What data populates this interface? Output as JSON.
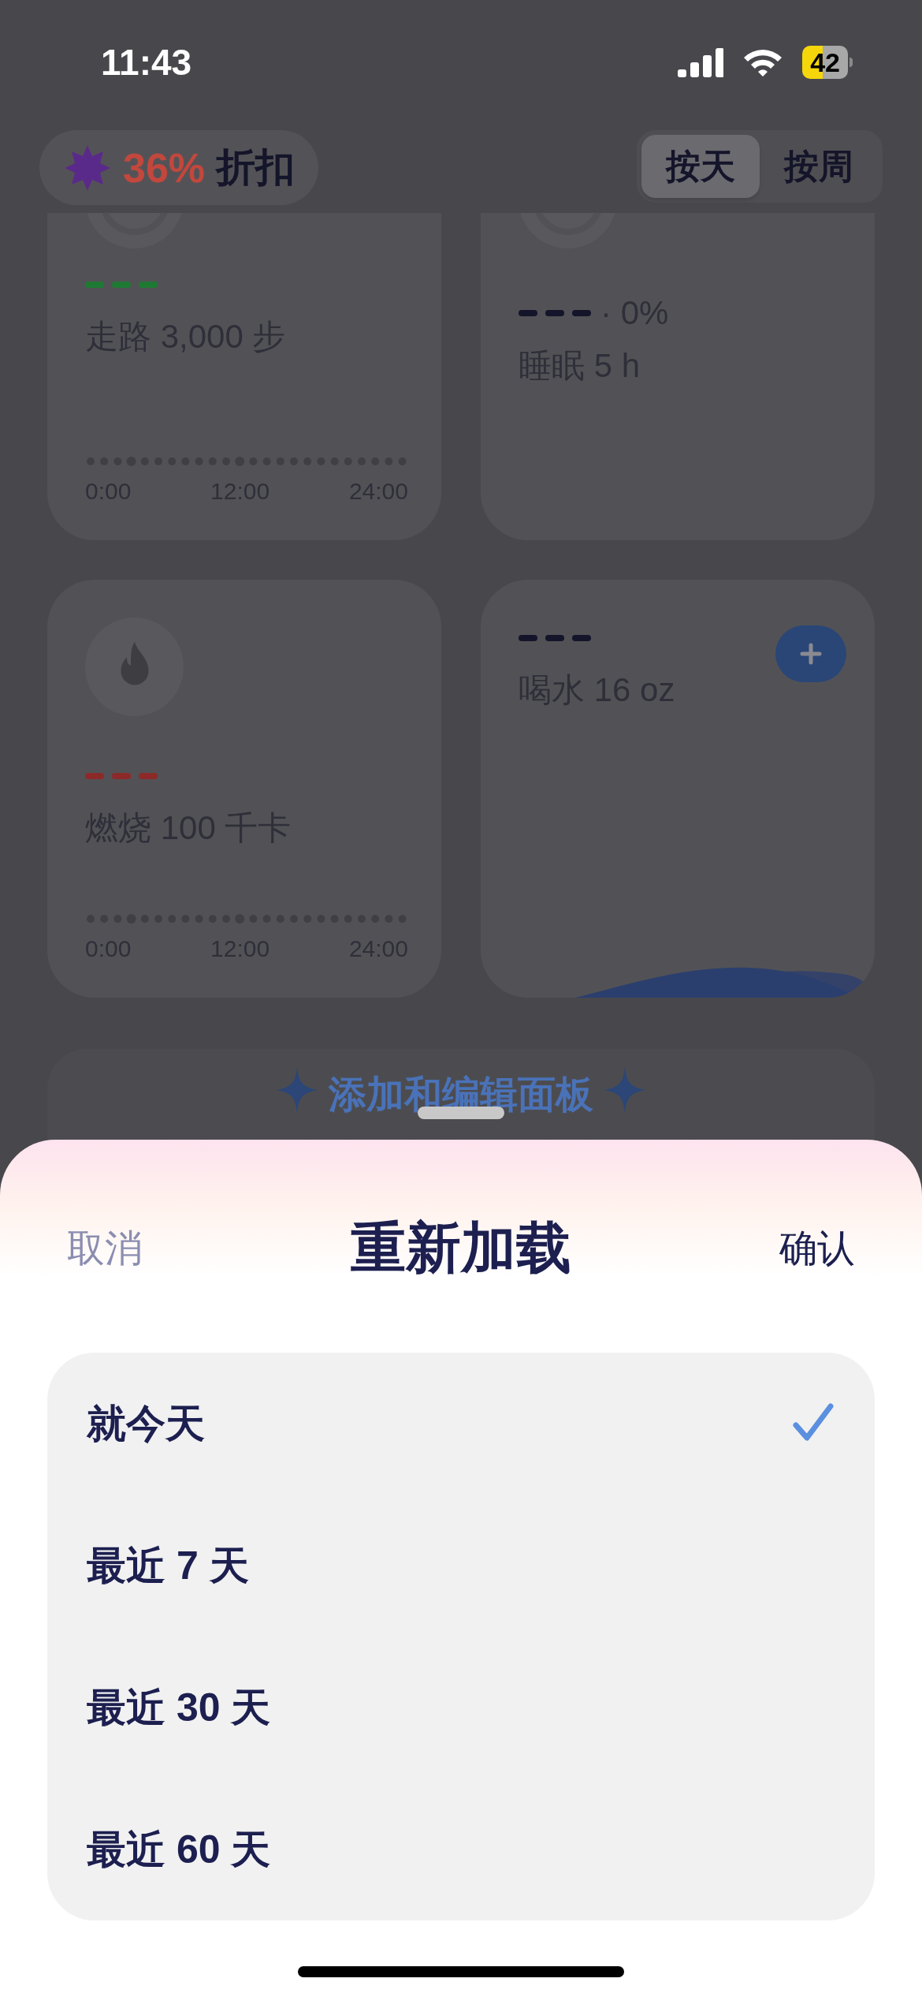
{
  "status_bar": {
    "time": "11:43",
    "battery": "42"
  },
  "discount": {
    "percent": "36%",
    "label": "折扣"
  },
  "segments": [
    {
      "label": "按天",
      "selected": true
    },
    {
      "label": "按周",
      "selected": false
    }
  ],
  "cards": [
    {
      "kind": "timeline",
      "color": "#1e7a33",
      "label": "走路 3,000 步",
      "axis": [
        "0:00",
        "12:00",
        "24:00"
      ]
    },
    {
      "kind": "ring",
      "color": "#14142a",
      "suffix": "· 0%",
      "label": "睡眠 5 h"
    },
    {
      "kind": "timeline",
      "color": "#8c2a2a",
      "label": "燃烧 100 千卡",
      "axis": [
        "0:00",
        "12:00",
        "24:00"
      ]
    },
    {
      "kind": "water",
      "color": "#14142a",
      "label": "喝水 16 oz"
    }
  ],
  "add_panel": {
    "label": "添加和编辑面板"
  },
  "sheet": {
    "cancel": "取消",
    "title": "重新加载",
    "confirm": "确认",
    "options": [
      {
        "label": "就今天",
        "selected": true
      },
      {
        "label": "最近 7 天",
        "selected": false
      },
      {
        "label": "最近 30 天",
        "selected": false
      },
      {
        "label": "最近 60 天",
        "selected": false
      }
    ]
  }
}
